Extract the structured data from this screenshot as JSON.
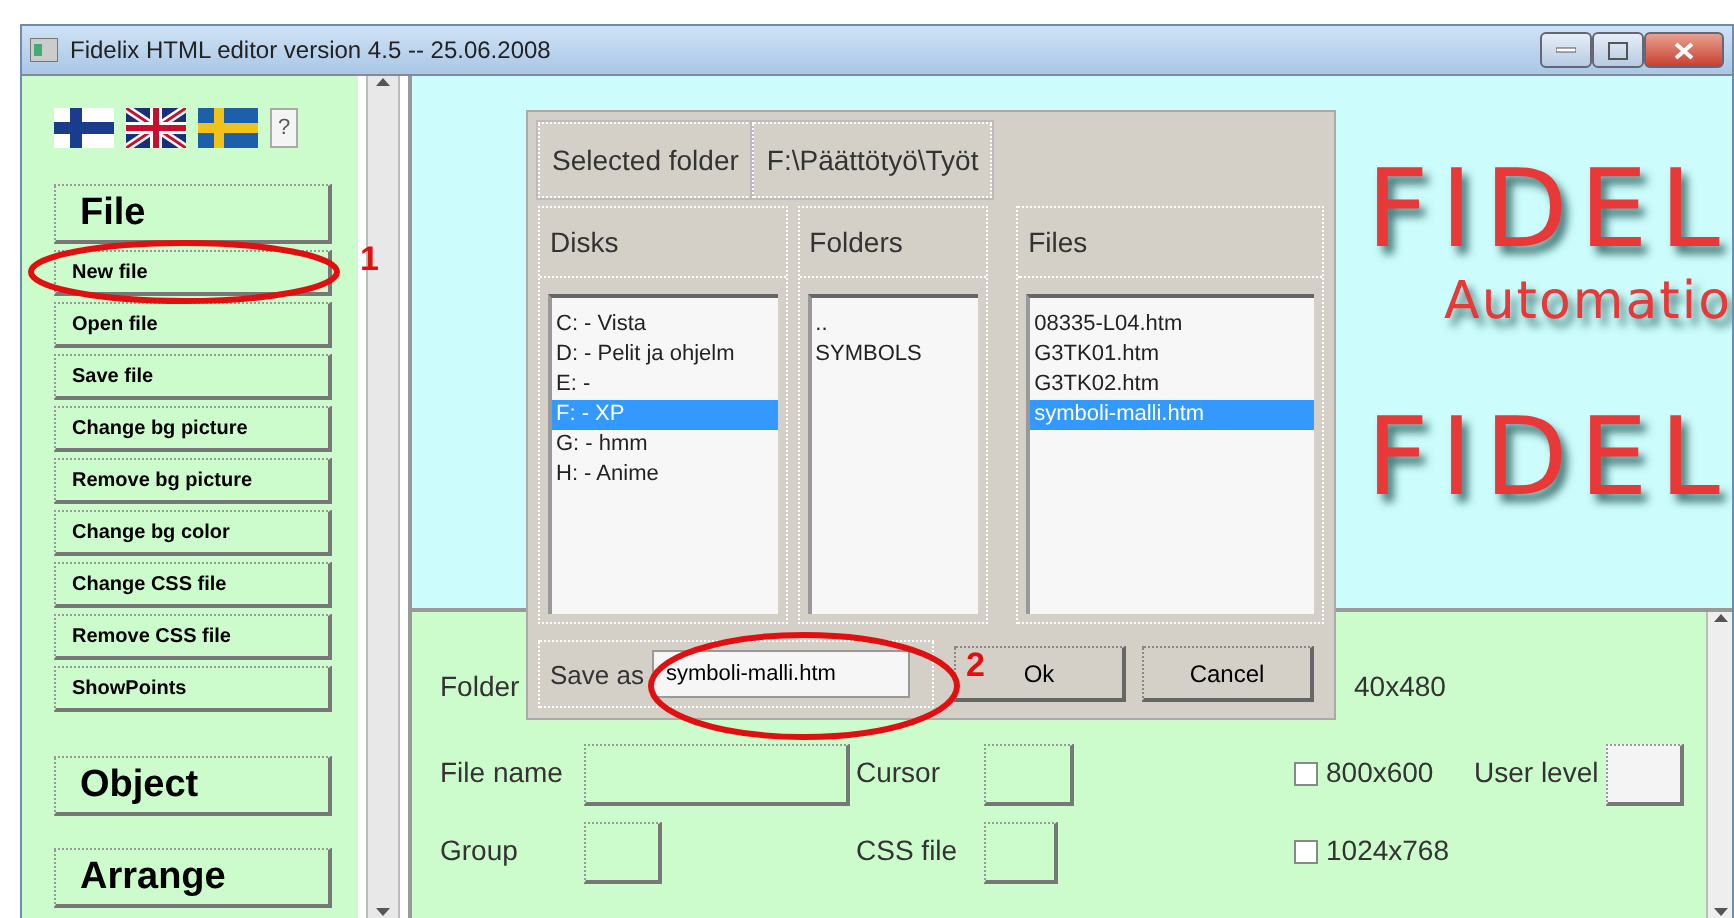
{
  "window": {
    "title": "Fidelix HTML editor version 4.5 -- 25.06.2008"
  },
  "sidebar": {
    "help_button": "?",
    "sections": [
      {
        "title": "File",
        "items": [
          "New file",
          "Open file",
          "Save file",
          "Change bg picture",
          "Remove bg picture",
          "Change bg color",
          "Change CSS file",
          "Remove CSS file",
          "ShowPoints"
        ]
      },
      {
        "title": "Object"
      },
      {
        "title": "Arrange"
      }
    ]
  },
  "canvas": {
    "logo_lines": [
      {
        "text": "FIDEL",
        "kind": "big"
      },
      {
        "text": "Automatio",
        "kind": "small"
      },
      {
        "text": "FIDEL",
        "kind": "big"
      }
    ]
  },
  "form": {
    "folder_label": "Folder",
    "file_name_label": "File name",
    "group_label": "Group",
    "cursor_label": "Cursor",
    "css_file_label": "CSS file",
    "user_level_label": "User level",
    "resolutions": [
      {
        "label": "40x480"
      },
      {
        "label": "800x600",
        "checked": false
      },
      {
        "label": "1024x768",
        "checked": false
      }
    ]
  },
  "dialog": {
    "selected_folder_label": "Selected folder",
    "selected_folder": "F:\\Päättötyö\\Työt",
    "panes": [
      {
        "title": "Disks",
        "items": [
          {
            "text": "C: - Vista",
            "selected": false
          },
          {
            "text": "D: - Pelit ja ohjelm",
            "selected": false
          },
          {
            "text": "E: -",
            "selected": false
          },
          {
            "text": "F: - XP",
            "selected": true
          },
          {
            "text": "G: - hmm",
            "selected": false
          },
          {
            "text": "H: - Anime",
            "selected": false
          }
        ]
      },
      {
        "title": "Folders",
        "items": [
          {
            "text": "..",
            "selected": false
          },
          {
            "text": "SYMBOLS",
            "selected": false
          }
        ]
      },
      {
        "title": "Files",
        "items": [
          {
            "text": "08335-L04.htm",
            "selected": false
          },
          {
            "text": "G3TK01.htm",
            "selected": false
          },
          {
            "text": "G3TK02.htm",
            "selected": false
          },
          {
            "text": "symboli-malli.htm",
            "selected": true
          }
        ]
      }
    ],
    "save_as_label": "Save as",
    "save_as_value": "symboli-malli.htm",
    "buttons": [
      "Ok",
      "Cancel"
    ]
  },
  "annotations": [
    {
      "number": "1",
      "color": "#e01010"
    },
    {
      "number": "2",
      "color": "#e01010"
    }
  ]
}
